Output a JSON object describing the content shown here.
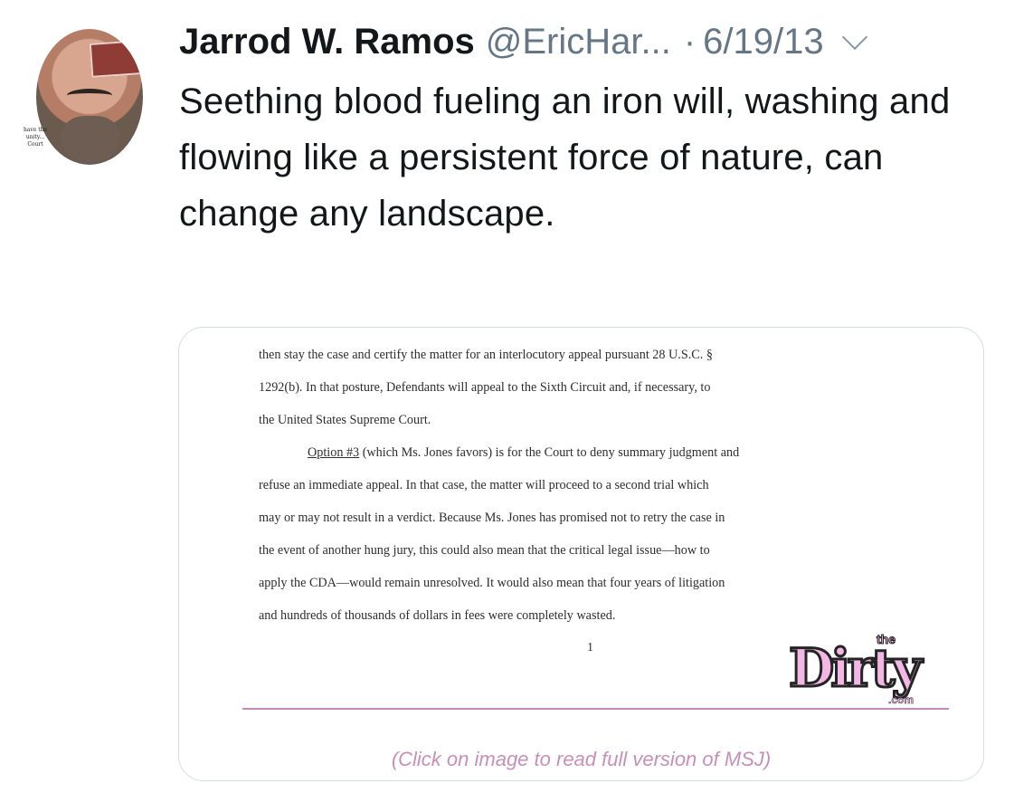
{
  "tweet": {
    "author_name": "Jarrod W. Ramos",
    "handle": "@EricHar...",
    "separator": "·",
    "date": "6/19/13",
    "text": "Seething blood fueling an iron will, washing and flowing like a persistent force of nature, can change any landscape.",
    "avatar_caption": "have the unity... Court",
    "menu_icon": "chevron-down-icon"
  },
  "media": {
    "document_lines": [
      "then stay the case and certify the matter for an interlocutory appeal pursuant 28 U.S.C. §",
      "1292(b). In that posture, Defendants will appeal to the Sixth Circuit and, if necessary, to",
      "the United States Supreme Court.",
      "(which Ms. Jones favors) is for the Court to deny summary judgment and",
      "refuse an immediate appeal. In that case, the matter will proceed to a second trial which",
      "may or may not result in a verdict. Because Ms. Jones has promised not to retry the case in",
      "the event of another hung jury, this could also mean that the critical legal issue—how to",
      "apply the CDA—would remain unresolved. It would also mean that four years of litigation",
      "and hundreds of thousands of dollars in fees were completely wasted."
    ],
    "option_label": "Option #3",
    "page_number": "1",
    "logo": {
      "main": "Dirty",
      "small_top": "the",
      "small_bottom": ".com"
    },
    "caption": "(Click on image to read full version of MSJ)"
  },
  "colors": {
    "name": "#14171a",
    "secondary": "#657786",
    "logo_pink": "#f2b7e4",
    "caption_pink": "#c790ba"
  }
}
